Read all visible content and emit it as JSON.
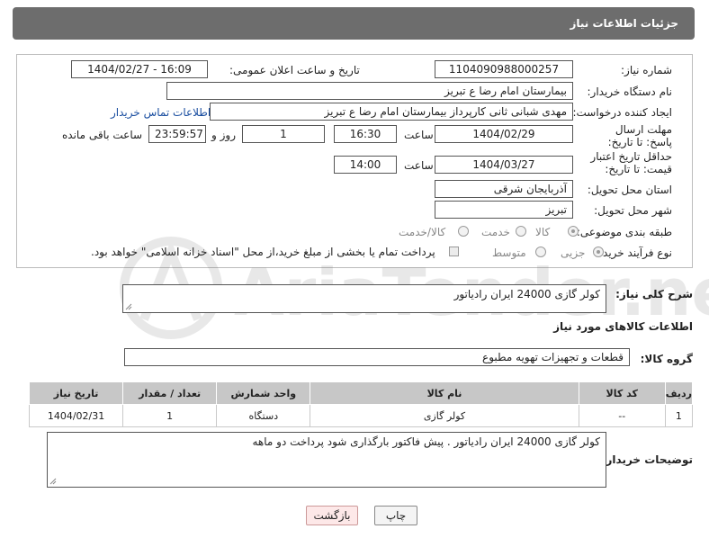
{
  "header": {
    "title": "جزئیات اطلاعات نیاز"
  },
  "form": {
    "need_number_label": "شماره نیاز:",
    "need_number": "1104090988000257",
    "announce_label": "تاریخ و ساعت اعلان عمومی:",
    "announce_value": "1404/02/27 - 16:09",
    "buyer_org_label": "نام دستگاه خریدار:",
    "buyer_org": "بیمارستان امام رضا  ع  تبریز",
    "creator_label": "ایجاد کننده درخواست:",
    "creator": "مهدی شبانی ثانی کارپرداز بیمارستان امام رضا  ع  تبریز",
    "contact_link": "اطلاعات تماس خریدار",
    "deadline_label": "مهلت ارسال پاسخ: تا تاریخ:",
    "deadline_date": "1404/02/29",
    "time_label": "ساعت",
    "deadline_time": "16:30",
    "days_value": "1",
    "day_and_label": "روز و",
    "remaining_time": "23:59:57",
    "remaining_label": "ساعت باقی مانده",
    "validity_label": "حداقل تاریخ اعتبار قیمت: تا تاریخ:",
    "validity_date": "1404/03/27",
    "validity_time_label": "ساعت",
    "validity_time": "14:00",
    "province_label": "استان محل تحویل:",
    "province": "آذربایجان شرقی",
    "city_label": "شهر محل تحویل:",
    "city": "تبریز",
    "category_label": "طبقه بندی موضوعی:",
    "category_options": [
      "کالا",
      "خدمت",
      "کالا/خدمت"
    ],
    "process_label": "نوع فرآیند خرید :",
    "process_options": [
      "جزیی",
      "متوسط"
    ],
    "payment_note": "پرداخت تمام یا بخشی از مبلغ خرید،از محل \"اسناد خزانه اسلامی\" خواهد بود."
  },
  "description": {
    "label": "شرح کلی نیاز:",
    "value": "کولر گازی 24000 ایران رادیاتور"
  },
  "goods": {
    "title": "اطلاعات کالاهای مورد نیاز",
    "group_label": "گروه کالا:",
    "group_value": "قطعات و تجهیزات تهویه مطبوع",
    "columns": [
      "ردیف",
      "کد کالا",
      "نام کالا",
      "واحد شمارش",
      "تعداد / مقدار",
      "تاریخ نیاز"
    ],
    "rows": [
      [
        "1",
        "--",
        "کولر گازی",
        "دستگاه",
        "1",
        "1404/02/31"
      ]
    ]
  },
  "buyer_notes": {
    "label": "توضیحات خریدار:",
    "value": "کولر گازی 24000 ایران رادیاتور . پیش فاکتور بارگذاری شود پرداخت دو ماهه"
  },
  "buttons": {
    "print": "چاپ",
    "back": "بازگشت"
  },
  "watermark": {
    "text": "AriaTender.neT"
  }
}
